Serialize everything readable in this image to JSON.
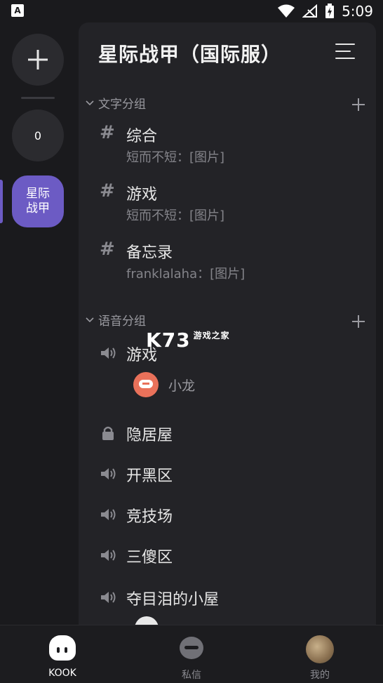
{
  "status_bar": {
    "time": "5:09",
    "app_icon_letter": "A"
  },
  "rail": {
    "add_icon": "plus-icon",
    "count": "0",
    "server_label_line1": "星际",
    "server_label_line2": "战甲",
    "accent": "#6c5bc4"
  },
  "server": {
    "title": "星际战甲（国际服）"
  },
  "categories": {
    "text": {
      "label": "文字分组"
    },
    "voice": {
      "label": "语音分组"
    }
  },
  "text_channels": [
    {
      "name": "综合",
      "last_message": "短而不短：[图片]"
    },
    {
      "name": "游戏",
      "last_message": "短而不短：[图片]"
    },
    {
      "name": "备忘录",
      "last_message": "franklalaha：[图片]"
    }
  ],
  "voice_channels": [
    {
      "name": "游戏",
      "icon": "speaker-icon"
    },
    {
      "name": "隐居屋",
      "icon": "lock-icon"
    },
    {
      "name": "开黑区",
      "icon": "speaker-icon"
    },
    {
      "name": "竞技场",
      "icon": "speaker-icon"
    },
    {
      "name": "三傻区",
      "icon": "speaker-icon"
    },
    {
      "name": "夺目泪的小屋",
      "icon": "speaker-icon"
    }
  ],
  "voice_members": [
    {
      "name": "小龙"
    }
  ],
  "watermark": {
    "brand": "K73",
    "tagline": "游戏之家"
  },
  "bottom_nav": [
    {
      "label": "KOOK",
      "active": true
    },
    {
      "label": "私信",
      "active": false
    },
    {
      "label": "我的",
      "active": false
    }
  ]
}
